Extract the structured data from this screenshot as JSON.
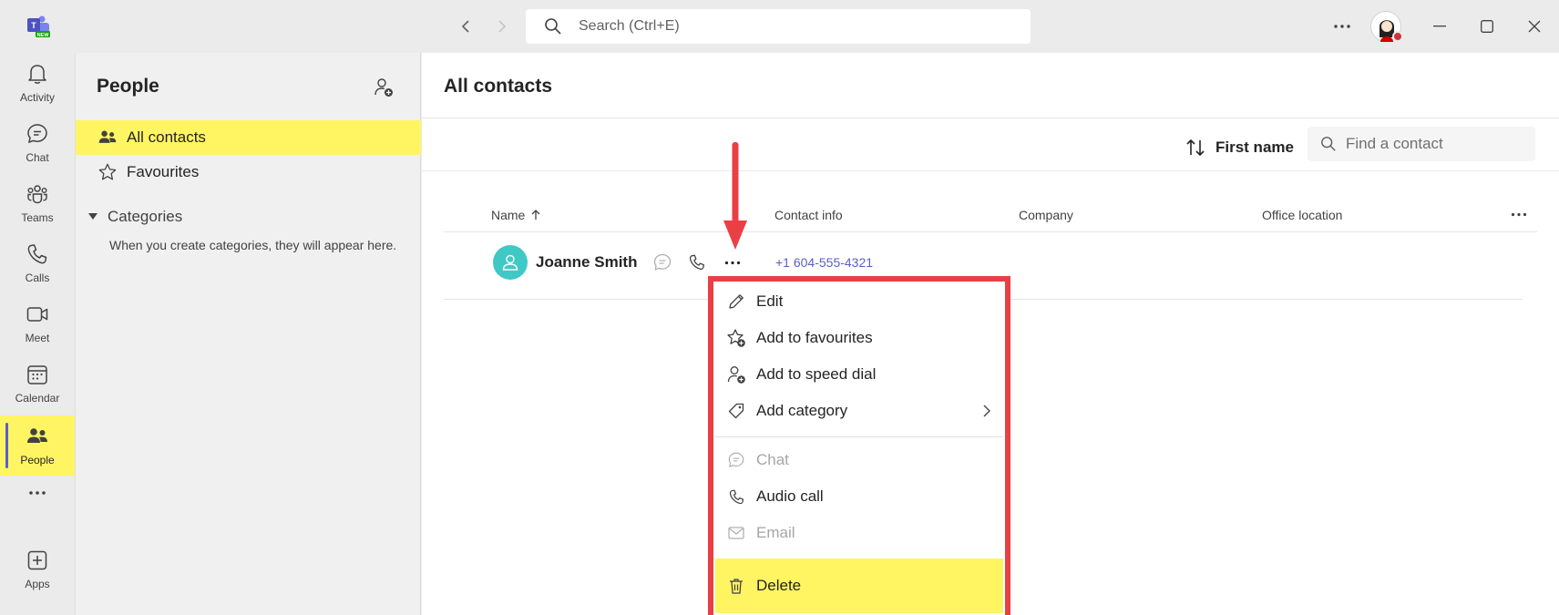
{
  "titlebar": {
    "search_placeholder": "Search (Ctrl+E)",
    "logo_badge": "NEW"
  },
  "rail": {
    "items": [
      {
        "label": "Activity",
        "icon": "bell-icon"
      },
      {
        "label": "Chat",
        "icon": "chat-icon"
      },
      {
        "label": "Teams",
        "icon": "teams-icon"
      },
      {
        "label": "Calls",
        "icon": "phone-icon"
      },
      {
        "label": "Meet",
        "icon": "video-icon"
      },
      {
        "label": "Calendar",
        "icon": "calendar-icon"
      },
      {
        "label": "People",
        "icon": "people-icon",
        "active": true
      },
      {
        "label": "Apps",
        "icon": "apps-icon"
      }
    ]
  },
  "panel": {
    "title": "People",
    "nav": [
      {
        "label": "All contacts",
        "icon": "people-icon",
        "active": true
      },
      {
        "label": "Favourites",
        "icon": "star-icon"
      }
    ],
    "categories_label": "Categories",
    "categories_hint": "When you create categories, they will appear here."
  },
  "main": {
    "title": "All contacts",
    "sort_label": "First name",
    "find_placeholder": "Find a contact",
    "columns": [
      "Name",
      "Contact info",
      "Company",
      "Office location"
    ],
    "contacts": [
      {
        "name": "Joanne Smith",
        "phone": "+1 604-555-4321"
      }
    ]
  },
  "context_menu": {
    "items": [
      {
        "label": "Edit",
        "icon": "pencil-icon",
        "disabled": false
      },
      {
        "label": "Add to favourites",
        "icon": "star-add-icon",
        "disabled": false
      },
      {
        "label": "Add to speed dial",
        "icon": "person-add-icon",
        "disabled": false
      },
      {
        "label": "Add category",
        "icon": "tag-icon",
        "disabled": false,
        "submenu": true
      },
      {
        "label": "Chat",
        "icon": "chat-icon",
        "disabled": true
      },
      {
        "label": "Audio call",
        "icon": "phone-icon",
        "disabled": false
      },
      {
        "label": "Email",
        "icon": "mail-icon",
        "disabled": true
      },
      {
        "label": "Delete",
        "icon": "trash-icon",
        "disabled": false,
        "highlighted": true
      }
    ]
  },
  "colors": {
    "highlight": "#fff562",
    "annotation": "#ea3f44",
    "accent": "#5b5fc7",
    "avatar": "#3fc8c6"
  }
}
